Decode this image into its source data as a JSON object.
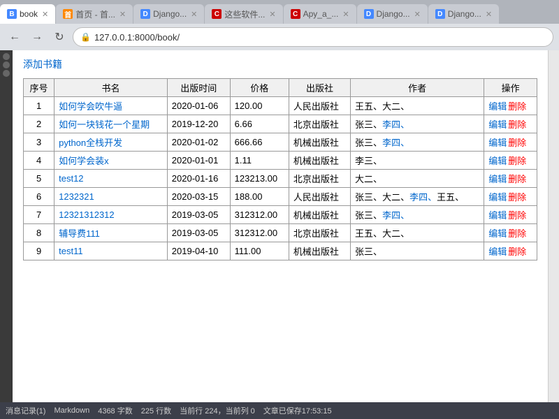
{
  "browser": {
    "tabs": [
      {
        "id": "book",
        "label": "book",
        "favicon": "B",
        "favicon_color": "fav-blue",
        "active": true
      },
      {
        "id": "home",
        "label": "首页 - 首...",
        "favicon": "首",
        "favicon_color": "fav-orange",
        "active": false
      },
      {
        "id": "django1",
        "label": "Django...",
        "favicon": "D",
        "favicon_color": "fav-blue",
        "active": false
      },
      {
        "id": "csoft",
        "label": "这些软件...",
        "favicon": "C",
        "favicon_color": "fav-red",
        "active": false
      },
      {
        "id": "apy",
        "label": "Apy_a_...",
        "favicon": "C",
        "favicon_color": "fav-red",
        "active": false
      },
      {
        "id": "django2",
        "label": "Django...",
        "favicon": "D",
        "favicon_color": "fav-blue",
        "active": false
      },
      {
        "id": "django3",
        "label": "Django...",
        "favicon": "D",
        "favicon_color": "fav-blue",
        "active": false
      }
    ],
    "address": "127.0.0.1:8000/book/",
    "back_btn": "←",
    "forward_btn": "→",
    "reload_btn": "↻"
  },
  "page": {
    "add_link": "添加书籍",
    "table": {
      "headers": [
        "序号",
        "书名",
        "出版时间",
        "价格",
        "出版社",
        "作者",
        "操作"
      ],
      "rows": [
        {
          "id": 1,
          "title": "如何学会吹牛逼",
          "pub_date": "2020-01-06",
          "price": "120.00",
          "publisher": "人民出版社",
          "authors": [
            {
              "name": "王五、",
              "link": false
            },
            {
              "name": "大二、",
              "link": false
            }
          ],
          "ops": {
            "edit": "编辑",
            "delete": "删除"
          }
        },
        {
          "id": 2,
          "title": "如何一块钱花一个星期",
          "pub_date": "2019-12-20",
          "price": "6.66",
          "publisher": "北京出版社",
          "authors": [
            {
              "name": "张三、",
              "link": false
            },
            {
              "name": "李四、",
              "link": true
            }
          ],
          "ops": {
            "edit": "编辑",
            "delete": "删除"
          }
        },
        {
          "id": 3,
          "title": "python全栈开发",
          "pub_date": "2020-01-02",
          "price": "666.66",
          "publisher": "机械出版社",
          "authors": [
            {
              "name": "张三、",
              "link": false
            },
            {
              "name": "李四、",
              "link": true
            }
          ],
          "ops": {
            "edit": "编辑",
            "delete": "删除"
          }
        },
        {
          "id": 4,
          "title": "如何学会装x",
          "pub_date": "2020-01-01",
          "price": "1.11",
          "publisher": "机械出版社",
          "authors": [
            {
              "name": "李三、",
              "link": false
            }
          ],
          "ops": {
            "edit": "编辑",
            "delete": "删除"
          }
        },
        {
          "id": 5,
          "title": "test12",
          "pub_date": "2020-01-16",
          "price": "123213.00",
          "publisher": "北京出版社",
          "authors": [
            {
              "name": "大二、",
              "link": false
            }
          ],
          "ops": {
            "edit": "编辑",
            "delete": "删除"
          }
        },
        {
          "id": 6,
          "title": "1232321",
          "pub_date": "2020-03-15",
          "price": "188.00",
          "publisher": "人民出版社",
          "authors": [
            {
              "name": "张三、",
              "link": false
            },
            {
              "name": "大二、",
              "link": false
            },
            {
              "name": "李四、",
              "link": true
            },
            {
              "name": "王五、",
              "link": false
            }
          ],
          "ops": {
            "edit": "编辑",
            "delete": "删除"
          }
        },
        {
          "id": 7,
          "title": "12321312312",
          "pub_date": "2019-03-05",
          "price": "312312.00",
          "publisher": "机械出版社",
          "authors": [
            {
              "name": "张三、",
              "link": false
            },
            {
              "name": "李四、",
              "link": true
            }
          ],
          "ops": {
            "edit": "编辑",
            "delete": "删除"
          }
        },
        {
          "id": 8,
          "title": "辅导费111",
          "pub_date": "2019-03-05",
          "price": "312312.00",
          "publisher": "北京出版社",
          "authors": [
            {
              "name": "王五、",
              "link": false
            },
            {
              "name": "大二、",
              "link": false
            }
          ],
          "ops": {
            "edit": "编辑",
            "delete": "删除"
          }
        },
        {
          "id": 9,
          "title": "test11",
          "pub_date": "2019-04-10",
          "price": "111.00",
          "publisher": "机械出版社",
          "authors": [
            {
              "name": "张三、",
              "link": false
            }
          ],
          "ops": {
            "edit": "编辑",
            "delete": "删除"
          }
        }
      ]
    }
  },
  "statusbar": {
    "message": "消息记录(1)",
    "mode": "Markdown",
    "char_count": "4368 字数",
    "line_count": "225 行数",
    "current_line": "当前行 224，当前列 0",
    "saved": "文章已保存17:53:15"
  }
}
